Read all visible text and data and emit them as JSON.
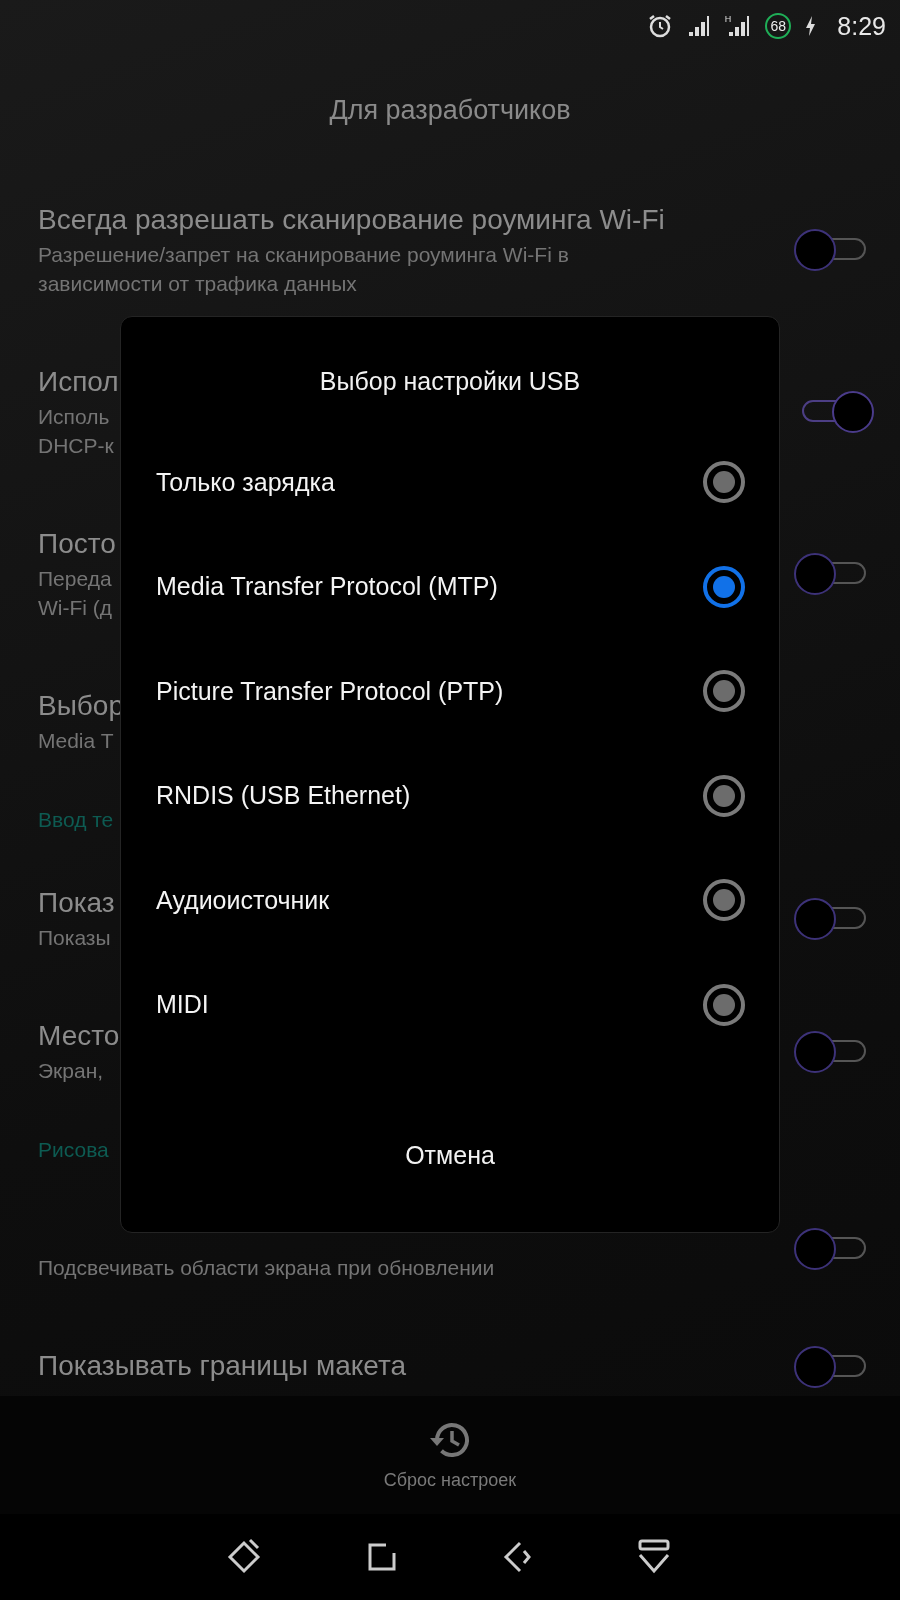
{
  "status_bar": {
    "network_type": "H",
    "battery": "68",
    "time": "8:29"
  },
  "header": {
    "title": "Для разработчиков"
  },
  "list": [
    {
      "kind": "switch",
      "title": "Всегда разрешать сканирование роуминга Wi-Fi",
      "summary": [
        "Разрешение/запрет на сканирование роуминга Wi-Fi в",
        "зависимости от трафика данных"
      ],
      "on": false
    },
    {
      "kind": "switch",
      "title": "Испол",
      "summary": [
        "Исполь",
        "DHCP-к"
      ],
      "on": true
    },
    {
      "kind": "switch",
      "title": "Посто",
      "summary": [
        "Переда",
        "Wi-Fi (д"
      ],
      "on": false
    },
    {
      "kind": "setting",
      "title": "Выбор",
      "summary": [
        "Media T"
      ]
    },
    {
      "kind": "category",
      "title": "Ввод те"
    },
    {
      "kind": "switch",
      "title": "Показ",
      "summary": [
        "Показы"
      ],
      "on": false
    },
    {
      "kind": "switch",
      "title": "Место",
      "summary": [
        "Экран,"
      ],
      "on": false
    },
    {
      "kind": "category",
      "title": "Рисова"
    },
    {
      "kind": "switch",
      "summary": [
        "Подсвечивать области экрана при обновлении"
      ],
      "on": false
    },
    {
      "kind": "switch",
      "title": "Показывать границы макета",
      "on": false
    }
  ],
  "reset": {
    "label": "Сброс настроек"
  },
  "dialog": {
    "title": "Выбор настройки USB",
    "options": [
      {
        "label": "Только зарядка",
        "selected": false
      },
      {
        "label": "Media Transfer Protocol (MTP)",
        "selected": true
      },
      {
        "label": "Picture Transfer Protocol (PTP)",
        "selected": false
      },
      {
        "label": "RNDIS (USB Ethernet)",
        "selected": false
      },
      {
        "label": "Аудиоисточник",
        "selected": false
      },
      {
        "label": "MIDI",
        "selected": false
      }
    ],
    "cancel": "Отмена"
  }
}
